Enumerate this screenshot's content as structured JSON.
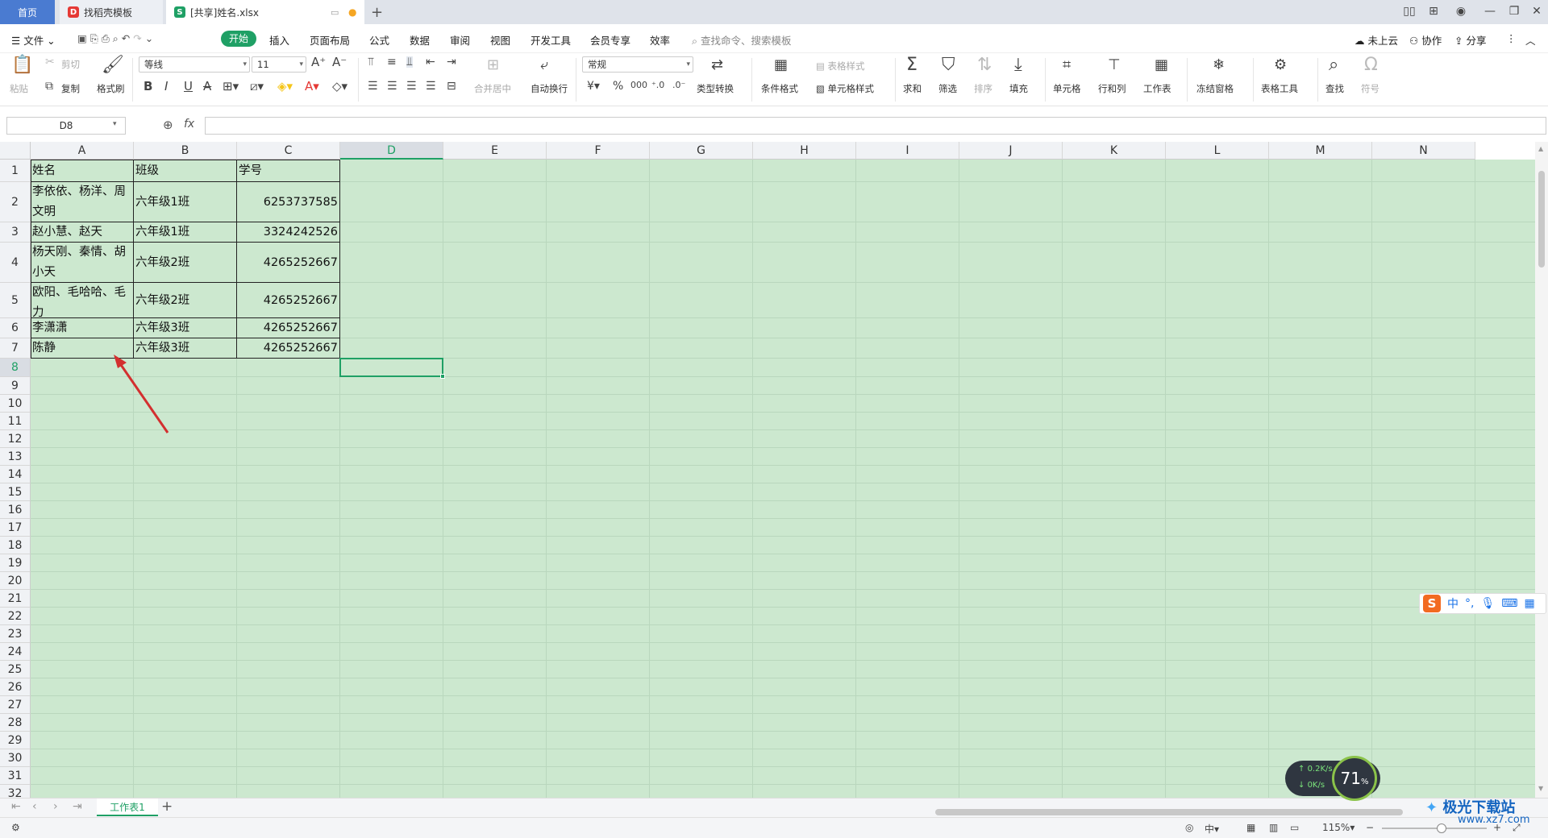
{
  "tabs": {
    "home": "首页",
    "docer": "找稻壳模板",
    "file": "[共享]姓名.xlsx",
    "new_tab": "+"
  },
  "menu": {
    "file": "文件",
    "start": "开始",
    "items": [
      "插入",
      "页面布局",
      "公式",
      "数据",
      "审阅",
      "视图",
      "开发工具",
      "会员专享",
      "效率"
    ],
    "search_placeholder": "查找命令、搜索模板",
    "cloud": "未上云",
    "collab": "协作",
    "share": "分享"
  },
  "ribbon": {
    "paste": "粘贴",
    "cut": "剪切",
    "copy": "复制",
    "format_painter": "格式刷",
    "font_name": "等线",
    "font_size": "11",
    "merge_center": "合并居中",
    "auto_wrap": "自动换行",
    "number_format": "常规",
    "type_convert": "类型转换",
    "conditional_format": "条件格式",
    "table_style": "表格样式",
    "cell_style": "单元格样式",
    "sum": "求和",
    "filter": "筛选",
    "sort": "排序",
    "fill": "填充",
    "cell": "单元格",
    "row_col": "行和列",
    "worksheet": "工作表",
    "freeze": "冻结窗格",
    "table_tools": "表格工具",
    "find": "查找",
    "symbol": "符号"
  },
  "formula_bar": {
    "name_box": "D8",
    "fx": "fx",
    "value": ""
  },
  "grid": {
    "columns": [
      "A",
      "B",
      "C",
      "D",
      "E",
      "F",
      "G",
      "H",
      "I",
      "J",
      "K",
      "L",
      "M",
      "N"
    ],
    "selected_column": "D",
    "selected_row": "8",
    "rows": [
      "1",
      "2",
      "3",
      "4",
      "5",
      "6",
      "7",
      "8",
      "9",
      "10",
      "11",
      "12",
      "13",
      "14",
      "15",
      "16",
      "17",
      "18",
      "19",
      "20",
      "21",
      "22",
      "23",
      "24",
      "25",
      "26",
      "27",
      "28",
      "29",
      "30",
      "31",
      "32"
    ],
    "data": [
      [
        "姓名",
        "班级",
        "学号"
      ],
      [
        "李依依、杨洋、周文明",
        "六年级1班",
        "6253737585"
      ],
      [
        "赵小慧、赵天",
        "六年级1班",
        "3324242526"
      ],
      [
        "杨天刚、秦情、胡小天",
        "六年级2班",
        "4265252667"
      ],
      [
        "欧阳、毛哈哈、毛力",
        "六年级2班",
        "4265252667"
      ],
      [
        "李潇潇",
        "六年级3班",
        "4265252667"
      ],
      [
        "陈静",
        "六年级3班",
        "4265252667"
      ]
    ]
  },
  "sheets": {
    "active": "工作表1",
    "add": "+"
  },
  "status": {
    "zoom": "115%",
    "input_mode": "中"
  },
  "ime": {
    "logo": "S",
    "lang": "中",
    "punct": "°,"
  },
  "network": {
    "up": "0.2K/s",
    "down": "0K/s",
    "percent": "71",
    "percent_unit": "%"
  },
  "watermark": {
    "name": "极光下载站",
    "url": "www.xz7.com"
  },
  "colors": {
    "accent": "#1fa065",
    "cell_bg": "#cce8cf",
    "home_tab": "#4a7bd1",
    "annotation_arrow": "#d32f2f"
  }
}
